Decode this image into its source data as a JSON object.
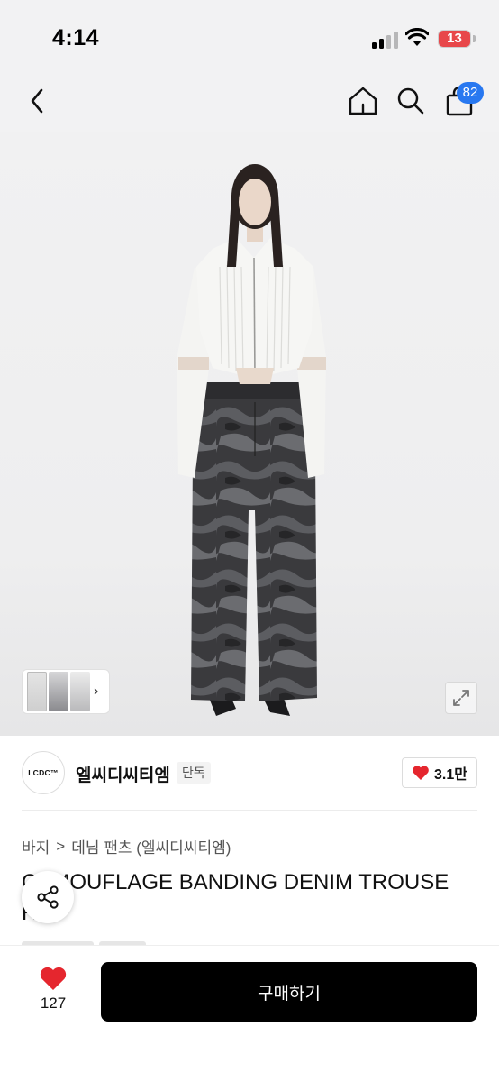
{
  "status_bar": {
    "time": "4:14",
    "battery": "13",
    "icons": [
      "signal-icon",
      "wifi-icon",
      "battery-icon"
    ]
  },
  "nav": {
    "icons": [
      "back-icon",
      "home-icon",
      "search-icon",
      "cart-icon"
    ],
    "cart_count": "82",
    "badge_color": "#2878f0"
  },
  "gallery": {
    "expand_icon": "expand-icon",
    "thumb_icon": "chevron-right-icon"
  },
  "brand": {
    "logo_text": "LCDC™",
    "name": "엘씨디씨티엠",
    "tag": "단독",
    "like_count": "3.1만",
    "heart_color": "#e5262e"
  },
  "breadcrumb": {
    "category": "바지",
    "separator": ">",
    "subcategory": "데님 팬츠 (엘씨디씨티엠)"
  },
  "product": {
    "title": "CAMOUFLAGE BANDING DENIM TROUSE",
    "title_line2": "R",
    "share_icon": "share-icon"
  },
  "bottom_bar": {
    "wish_count": "127",
    "buy_label": "구매하기",
    "button_color": "#000000"
  }
}
